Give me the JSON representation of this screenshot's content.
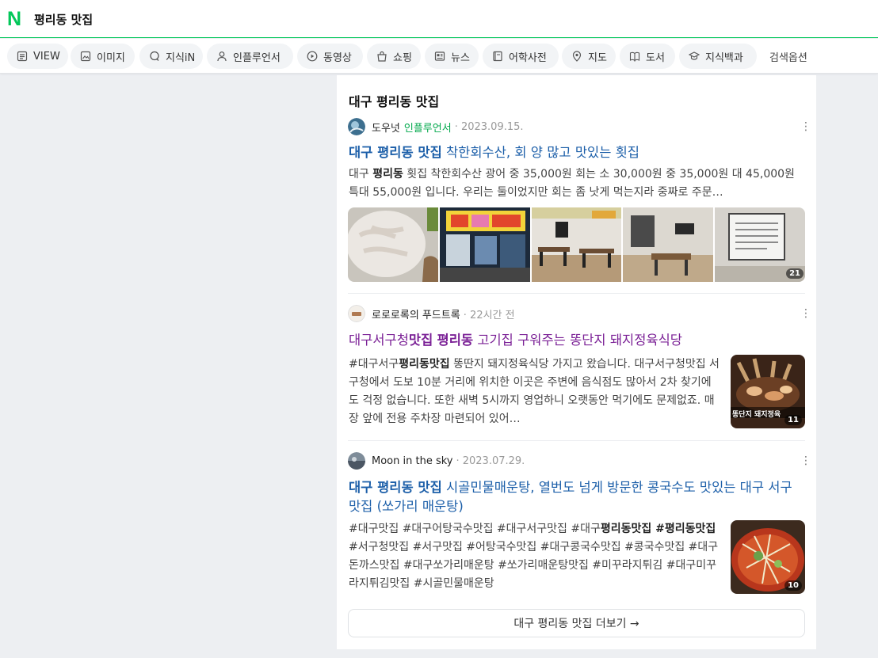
{
  "header": {
    "logo": "N",
    "query": "평리동 맛집"
  },
  "tabs": [
    {
      "label": "VIEW",
      "icon": "view-icon"
    },
    {
      "label": "이미지",
      "icon": "image-icon"
    },
    {
      "label": "지식iN",
      "icon": "q-icon"
    },
    {
      "label": "인플루언서",
      "icon": "person-icon"
    },
    {
      "label": "동영상",
      "icon": "play-icon"
    },
    {
      "label": "쇼핑",
      "icon": "bag-icon"
    },
    {
      "label": "뉴스",
      "icon": "news-icon"
    },
    {
      "label": "어학사전",
      "icon": "dictionary-icon"
    },
    {
      "label": "지도",
      "icon": "map-pin-icon"
    },
    {
      "label": "도서",
      "icon": "book-icon"
    },
    {
      "label": "지식백과",
      "icon": "cap-icon"
    },
    {
      "label": "검색옵션",
      "icon": ""
    }
  ],
  "section": {
    "title": "대구 평리동 맛집",
    "more_button": "대구 평리동 맛집 더보기 →"
  },
  "posts": [
    {
      "author": "도우넛",
      "badge": "인플루언서",
      "date": "· 2023.09.15.",
      "title_hl": "대구 평리동 맛집",
      "title_rest": " 착한회수산, 회 양 많고 맛있는 횟집",
      "desc_pre": "대구 ",
      "desc_hl": "평리동",
      "desc_rest": " 횟집 착한회수산 광어 중 35,000원 회는 소 30,000원 중 35,000원 대 45,000원 특대 55,000원 입니다. 우리는 둘이었지만 회는 좀 낫게 먹는지라 중짜로 주문…",
      "image_count": "21"
    },
    {
      "author": "로로로록의 푸드트록",
      "date": "· 22시간 전",
      "title_a": "대구서구청",
      "title_hl1": "맛집",
      "title_hl2": "평리동",
      "title_rest": " 고기집 구워주는 똥단지 돼지정육식당",
      "desc_pre": "#대구서구",
      "desc_hl": "평리동맛집",
      "desc_rest": " 똥딴지 돼지정육식당 가지고 왔습니다. 대구서구청맛집 서구청에서 도보 10분 거리에 위치한 이곳은 주변에 음식점도 많아서 2차 찾기에도 걱정 없습니다. 또한 새벽 5시까지 영업하니 오랫동안 먹기에도 문제없죠. 매장 앞에 전용 주차장 마련되어 있어…",
      "thumb_caption": "똥단지 돼지정육",
      "image_count": "11"
    },
    {
      "author": "Moon in the sky",
      "date": "· 2023.07.29.",
      "title_hl": "대구 평리동 맛집",
      "title_rest": " 시골민물매운탕, 열번도 넘게 방문한 콩국수도 맛있는 대구 서구 맛집 (쏘가리 매운탕)",
      "desc_pre": "#대구맛집 #대구어탕국수맛집 #대구서구맛집 #대구",
      "desc_hl": "평리동맛집 #평리동맛집",
      "desc_rest": " #서구청맛집 #서구맛집 #어탕국수맛집 #대구콩국수맛집 #콩국수맛집 #대구돈까스맛집 #대구쏘가리매운탕 #쏘가리매운탕맛집 #미꾸라지튀김 #대구미꾸라지튀김맛집 #시골민물매운탕",
      "image_count": "10"
    }
  ],
  "colors": {
    "brand": "#03c75a",
    "link": "#1c5fa9",
    "visited": "#7b2196"
  }
}
